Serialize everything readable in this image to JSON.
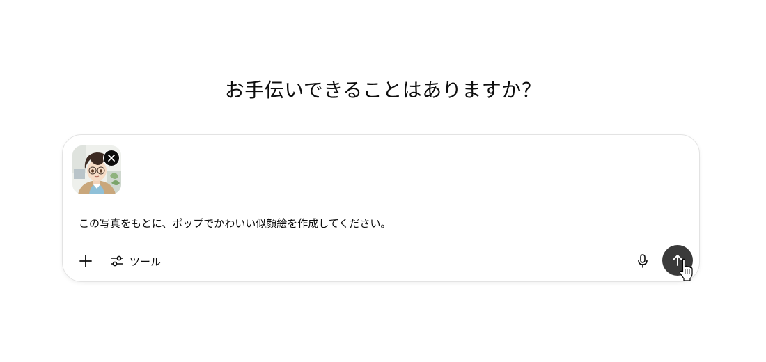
{
  "heading": "お手伝いできることはありますか？",
  "composer": {
    "prompt_text": "この写真をもとに、ポップでかわいい似顔絵を作成してください。",
    "attachment": {
      "kind": "image-thumbnail",
      "remove_icon": "close-icon"
    },
    "toolbar": {
      "add_icon": "plus-icon",
      "tools_icon": "sliders-icon",
      "tools_label": "ツール",
      "mic_icon": "microphone-icon",
      "send_icon": "arrow-up-icon"
    }
  },
  "colors": {
    "send_button": "#3a3a3a",
    "border": "#e3e3e3",
    "text": "#0d0d0d"
  }
}
